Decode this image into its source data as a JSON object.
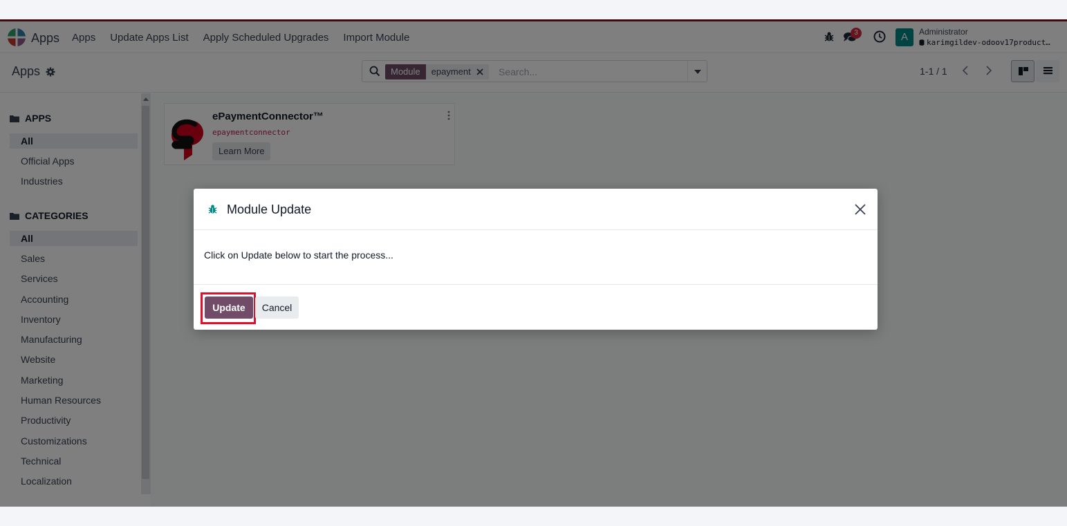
{
  "navbar": {
    "app_title": "Apps",
    "menu": [
      "Apps",
      "Update Apps List",
      "Apply Scheduled Upgrades",
      "Import Module"
    ],
    "messages_badge": "3",
    "avatar_initial": "A",
    "user_name": "Administrator",
    "database": "karimgildev-odoov17product…"
  },
  "control_panel": {
    "title": "Apps",
    "search": {
      "facet_label": "Module",
      "facet_value": "epayment",
      "placeholder": "Search..."
    },
    "pager": "1-1 / 1"
  },
  "sidebar": {
    "apps_header": "APPS",
    "apps_items": [
      "All",
      "Official Apps",
      "Industries"
    ],
    "categories_header": "CATEGORIES",
    "category_items": [
      "All",
      "Sales",
      "Services",
      "Accounting",
      "Inventory",
      "Manufacturing",
      "Website",
      "Marketing",
      "Human Resources",
      "Productivity",
      "Customizations",
      "Technical",
      "Localization"
    ]
  },
  "card": {
    "title": "ePaymentConnector™",
    "technical_name": "epaymentconnector",
    "button": "Learn More"
  },
  "dialog": {
    "title": "Module Update",
    "message": "Click on Update below to start the process...",
    "update_label": "Update",
    "cancel_label": "Cancel"
  },
  "colors": {
    "primary": "#714b67",
    "highlight": "#e0102d",
    "badge": "#d1293d",
    "avatar": "#018786"
  }
}
